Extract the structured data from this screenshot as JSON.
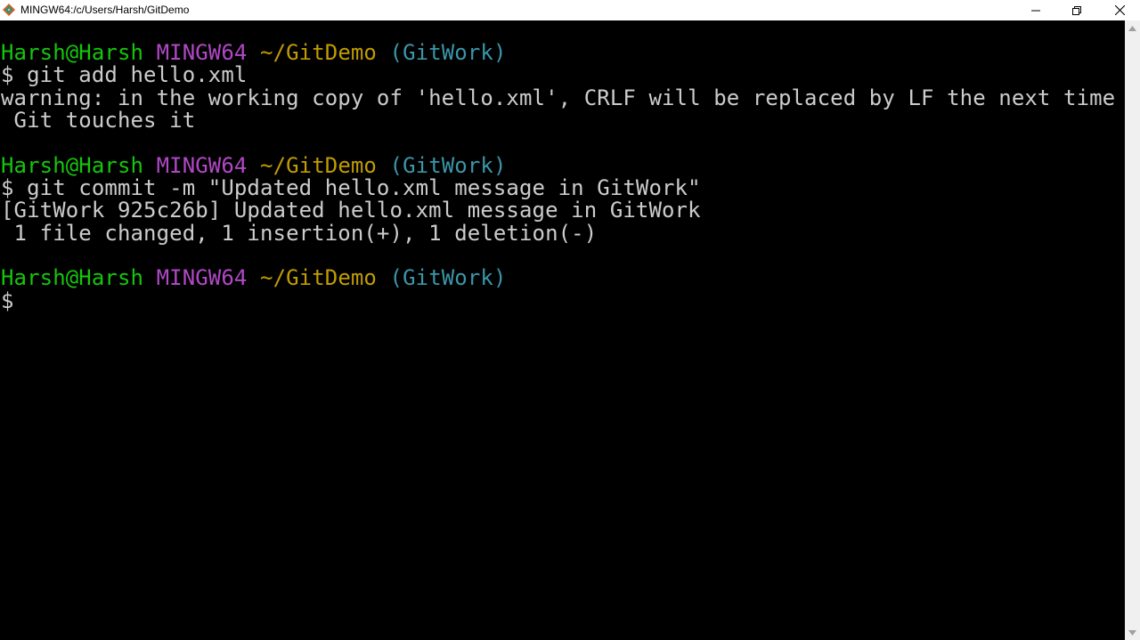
{
  "window": {
    "title": "MINGW64:/c/Users/Harsh/GitDemo",
    "minimize_icon": "minimize-icon",
    "maximize_icon": "restore-icon",
    "close_icon": "close-icon"
  },
  "colors": {
    "background": "#000000",
    "text": "#cccccc",
    "prompt_user": "#16c60c",
    "prompt_host": "#b148c6",
    "prompt_path": "#c19c00",
    "prompt_branch": "#3a96a8"
  },
  "terminal": {
    "prompt_1": {
      "user": "Harsh@Harsh",
      "host": "MINGW64",
      "path": "~/GitDemo",
      "branch": "(GitWork)"
    },
    "command_1": "$ git add hello.xml",
    "output_1a": "warning: in the working copy of 'hello.xml', CRLF will be replaced by LF the next time",
    "output_1b": " Git touches it",
    "prompt_2": {
      "user": "Harsh@Harsh",
      "host": "MINGW64",
      "path": "~/GitDemo",
      "branch": "(GitWork)"
    },
    "command_2": "$ git commit -m \"Updated hello.xml message in GitWork\"",
    "output_2a": "[GitWork 925c26b] Updated hello.xml message in GitWork",
    "output_2b": " 1 file changed, 1 insertion(+), 1 deletion(-)",
    "prompt_3": {
      "user": "Harsh@Harsh",
      "host": "MINGW64",
      "path": "~/GitDemo",
      "branch": "(GitWork)"
    },
    "command_3": "$"
  }
}
